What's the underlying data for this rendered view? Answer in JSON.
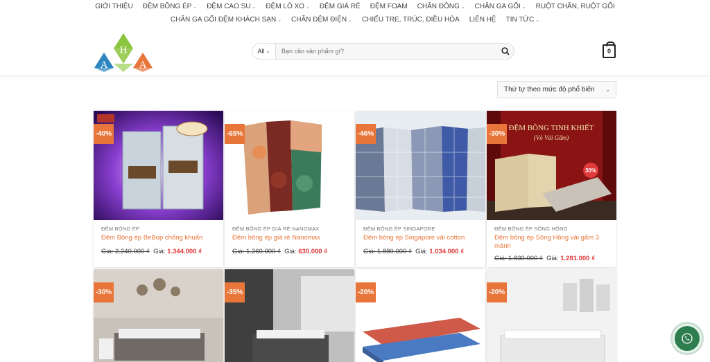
{
  "nav": {
    "row1": [
      {
        "label": "GIỚI THIỆU",
        "dropdown": false
      },
      {
        "label": "ĐỆM BÔNG ÉP",
        "dropdown": true
      },
      {
        "label": "ĐỆM CAO SU",
        "dropdown": true
      },
      {
        "label": "ĐỆM LÒ XO",
        "dropdown": true
      },
      {
        "label": "ĐỆM GIÁ RẺ",
        "dropdown": false
      },
      {
        "label": "ĐỆM FOAM",
        "dropdown": false
      },
      {
        "label": "CHĂN ĐÔNG",
        "dropdown": true
      },
      {
        "label": "CHĂN GA GỐI",
        "dropdown": true
      },
      {
        "label": "RUỘT CHĂN, RUỘT GỐI",
        "dropdown": false
      }
    ],
    "row2": [
      {
        "label": "CHĂN GA GỐI ĐỆM KHÁCH SẠN",
        "dropdown": true
      },
      {
        "label": "CHĂN ĐỆM ĐIỆN",
        "dropdown": true
      },
      {
        "label": "CHIẾU TRE, TRÚC, ĐIỀU HÒA",
        "dropdown": false
      },
      {
        "label": "LIÊN HỆ",
        "dropdown": false
      },
      {
        "label": "TIN TỨC",
        "dropdown": true
      }
    ]
  },
  "logo": {
    "letters": [
      "H",
      "A",
      "A"
    ]
  },
  "search": {
    "category": "All",
    "placeholder": "Bạn cần sản phẩm gì?",
    "icon": "search-icon"
  },
  "cart": {
    "count": "0",
    "icon": "cart-icon"
  },
  "sort": {
    "selected": "Thứ tự theo mức độ phổ biến"
  },
  "products": [
    {
      "badge": "-40%",
      "category": "ĐỆM BÔNG ÉP",
      "name": "Đệm Bông ép BeBop chống khuẩn",
      "old_price": "Giá: 2.240.000 ₫",
      "price_label": "Giá:",
      "price": "1.344.000 ₫"
    },
    {
      "badge": "-65%",
      "category": "ĐỆM BÔNG ÉP GIÁ RẺ NANOMAX",
      "name": "Đệm bông ép giá rẻ Nanomax",
      "old_price": "Giá: 1.260.000 ₫",
      "price_label": "Giá:",
      "price": "630.000 ₫"
    },
    {
      "badge": "-46%",
      "category": "ĐỆM BÔNG ÉP SINGAPORE",
      "name": "Đệm bông ép Singapore vải cotton",
      "old_price": "Giá: 1.880.000 ₫",
      "price_label": "Giá:",
      "price": "1.034.000 ₫"
    },
    {
      "badge": "-30%",
      "category": "ĐỆM BÔNG ÉP SÔNG HỒNG",
      "name": "Đệm bông ép Sông Hồng vải gấm 3 mảnh",
      "old_price": "Giá: 1.830.000 ₫",
      "price_label": "Giá:",
      "price": "1.281.000 ₫",
      "image_text": "ĐỆM BÔNG TINH KHIẾT",
      "image_subtext": "(Vỏ Vải Gấm)",
      "image_tag": "30%"
    },
    {
      "badge": "-30%"
    },
    {
      "badge": "-35%"
    },
    {
      "badge": "-20%"
    },
    {
      "badge": "-20%"
    }
  ],
  "floating": {
    "icon": "phone-icon"
  }
}
